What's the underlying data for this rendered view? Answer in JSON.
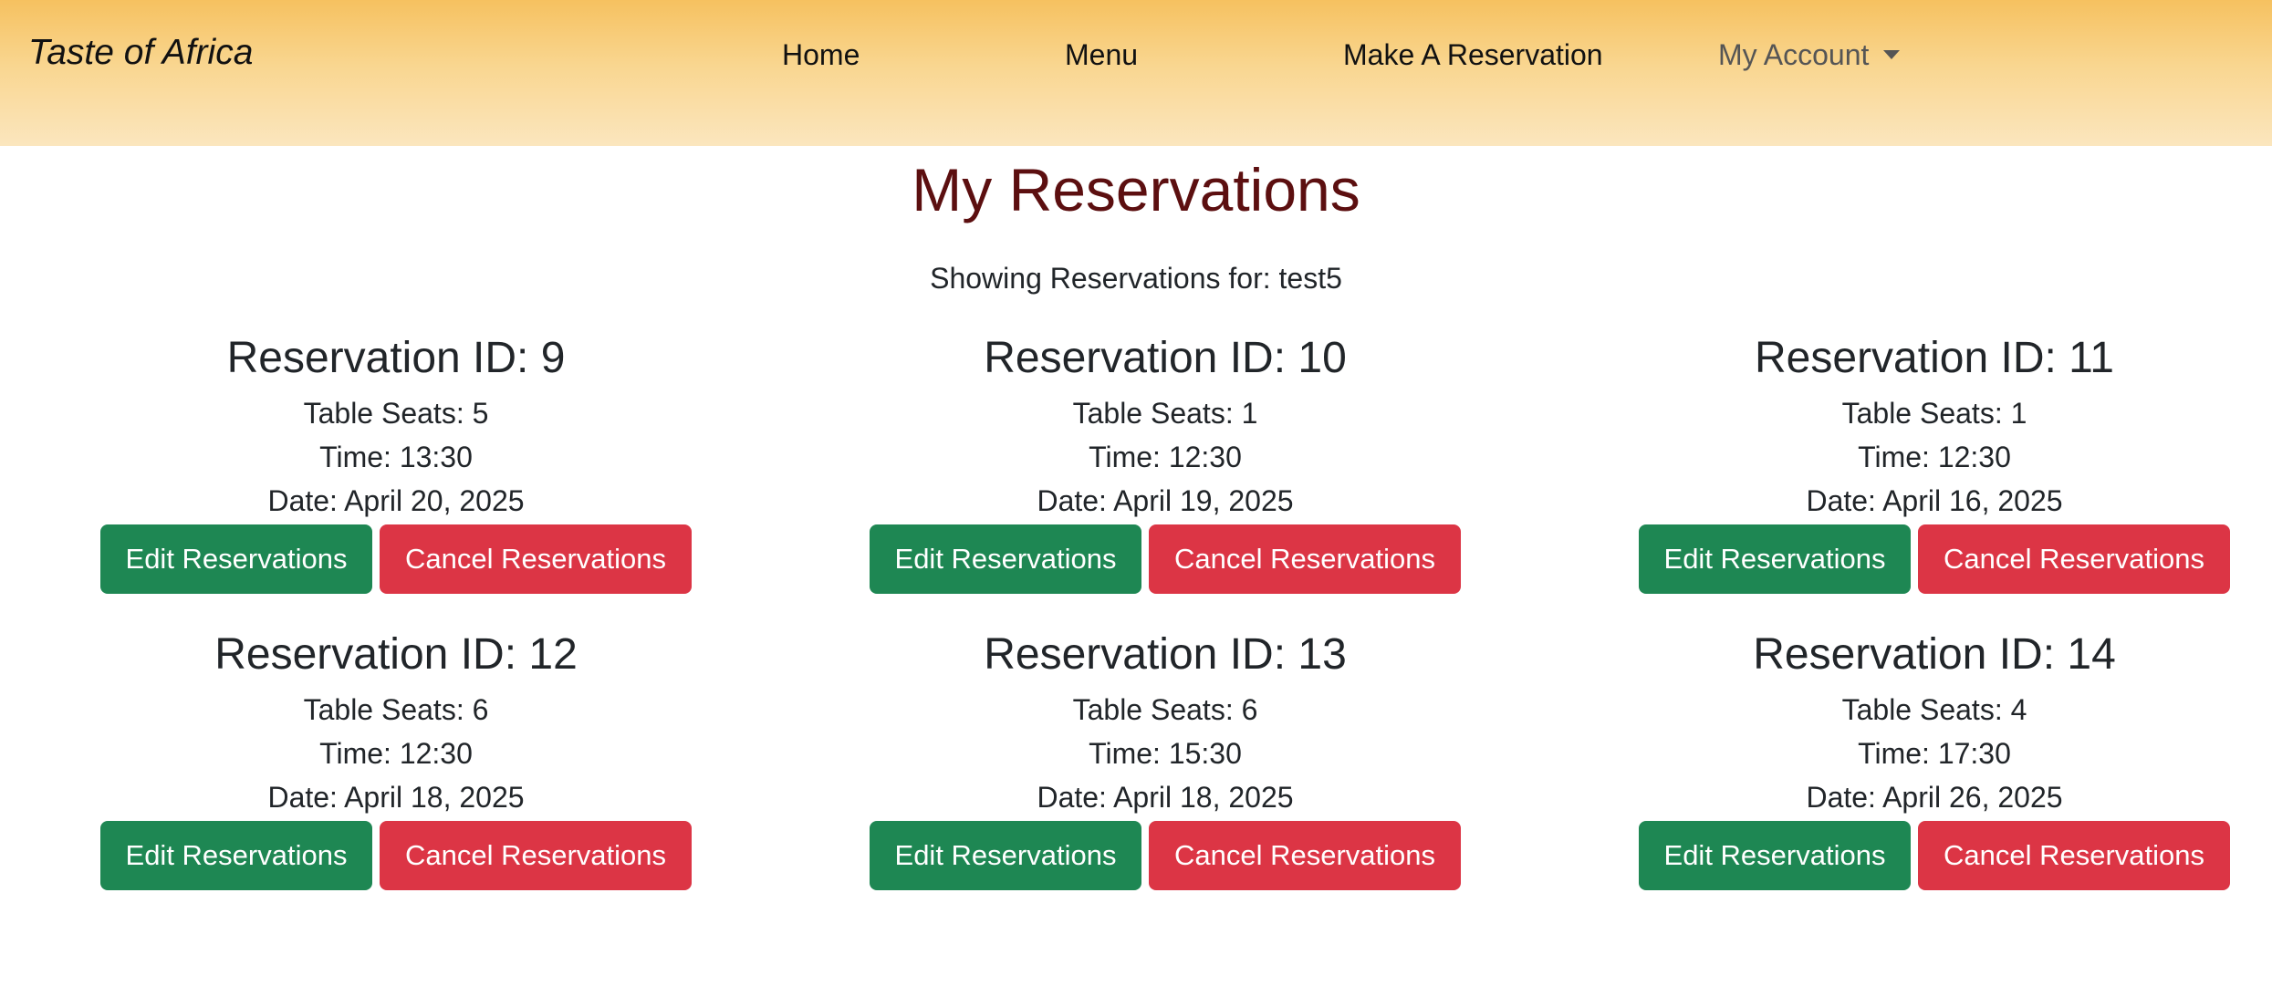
{
  "nav": {
    "brand": "Taste of Africa",
    "home": "Home",
    "menu": "Menu",
    "reserve": "Make A Reservation",
    "account": "My Account"
  },
  "page": {
    "title": "My Reservations",
    "subtitle": "Showing Reservations for: test5"
  },
  "buttons": {
    "edit": "Edit Reservations",
    "cancel": "Cancel Reservations"
  },
  "reservations": [
    {
      "heading": "Reservation ID: 9",
      "seats": "Table Seats: 5",
      "time": "Time: 13:30",
      "date": "Date: April 20, 2025"
    },
    {
      "heading": "Reservation ID: 10",
      "seats": "Table Seats: 1",
      "time": "Time: 12:30",
      "date": "Date: April 19, 2025"
    },
    {
      "heading": "Reservation ID: 11",
      "seats": "Table Seats: 1",
      "time": "Time: 12:30",
      "date": "Date: April 16, 2025"
    },
    {
      "heading": "Reservation ID: 12",
      "seats": "Table Seats: 6",
      "time": "Time: 12:30",
      "date": "Date: April 18, 2025"
    },
    {
      "heading": "Reservation ID: 13",
      "seats": "Table Seats: 6",
      "time": "Time: 15:30",
      "date": "Date: April 18, 2025"
    },
    {
      "heading": "Reservation ID: 14",
      "seats": "Table Seats: 4",
      "time": "Time: 17:30",
      "date": "Date: April 26, 2025"
    }
  ],
  "colors": {
    "title": "#5c0f10",
    "edit_button": "#1e8753",
    "cancel_button": "#dc3545"
  }
}
